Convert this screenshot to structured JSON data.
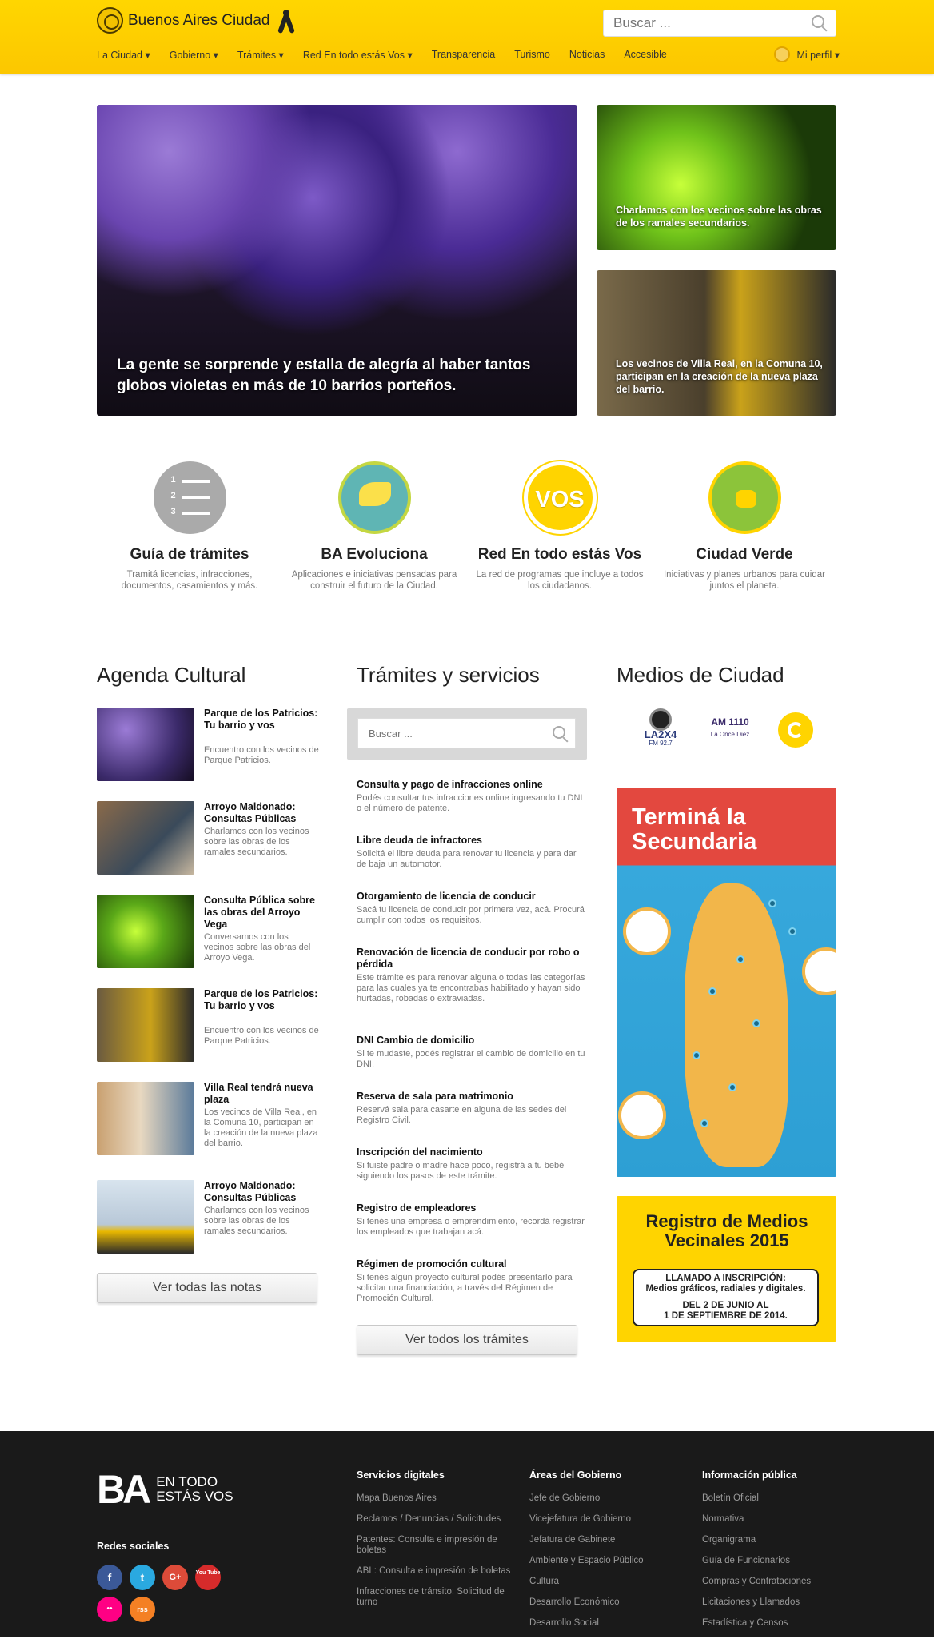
{
  "header": {
    "site_name": "Buenos Aires Ciudad",
    "search_placeholder": "Buscar ...",
    "nav": [
      "La Ciudad ▾",
      "Gobierno ▾",
      "Trámites ▾",
      "Red En todo estás Vos ▾",
      "Transparencia",
      "Turismo",
      "Noticias",
      "Accesible"
    ],
    "profile": "Mi perfil ▾"
  },
  "hero": {
    "main_caption": "La gente se sorprende y estalla de alegría al haber tantos globos violetas en más de 10 barrios porteños.",
    "side1_caption": "Charlamos con los vecinos sobre las obras de los ramales secundarios.",
    "side2_caption": "Los vecinos de Villa Real, en la Comuna 10, participan en la creación de la nueva plaza del barrio."
  },
  "features": [
    {
      "title": "Guía de trámites",
      "desc": "Tramitá licencias, infracciones, documentos, casamientos y más.",
      "icon": "list-icon"
    },
    {
      "title": "BA Evoluciona",
      "desc": "Aplicaciones e iniciativas pensadas para construir el futuro de la Ciudad.",
      "icon": "ba-evoluciona-logo"
    },
    {
      "title": "Red En todo estás Vos",
      "desc": "La red de programas que incluye a todos los ciudadanos.",
      "icon": "vos-logo",
      "logo_text": "VOS"
    },
    {
      "title": "Ciudad Verde",
      "desc": "Iniciativas y planes urbanos para cuidar juntos el planeta.",
      "icon": "ciudad-verde-logo"
    }
  ],
  "agenda": {
    "title": "Agenda Cultural",
    "items": [
      {
        "title": "Parque de los Patricios: Tu barrio y vos",
        "desc": "Encuentro con los vecinos de Parque Patricios."
      },
      {
        "title": "Arroyo Maldonado: Consultas Públicas",
        "desc": "Charlamos con los vecinos sobre las obras de los ramales secundarios."
      },
      {
        "title": "Consulta Pública sobre las obras del Arroyo Vega",
        "desc": "Conversamos con los vecinos sobre las obras del Arroyo Vega."
      },
      {
        "title": "Parque de los Patricios: Tu barrio y vos",
        "desc": "Encuentro con los vecinos de Parque Patricios."
      },
      {
        "title": "Villa Real tendrá nueva plaza",
        "desc": "Los vecinos de Villa Real, en la Comuna 10, participan en la creación de la nueva plaza del barrio."
      },
      {
        "title": "Arroyo Maldonado: Consultas Públicas",
        "desc": "Charlamos con los vecinos sobre las obras de los ramales secundarios."
      }
    ],
    "button": "Ver todas las notas"
  },
  "tramites": {
    "title": "Trámites y servicios",
    "search_placeholder": "Buscar ...",
    "items": [
      {
        "title": "Consulta y pago de infracciones online",
        "desc": "Podés consultar tus infracciones online ingresando tu DNI o el número de patente."
      },
      {
        "title": "Libre deuda de infractores",
        "desc": "Solicitá el libre deuda para renovar tu licencia y para dar de baja un automotor."
      },
      {
        "title": "Otorgamiento de licencia de conducir",
        "desc": "Sacá tu licencia de conducir por primera vez, acá. Procurá cumplir con todos los requisitos."
      },
      {
        "title": "Renovación de licencia de conducir por robo o pérdida",
        "desc": "Este trámite es para renovar alguna o todas las categorías para las cuales ya te encontrabas habilitado y hayan sido hurtadas, robadas o extraviadas."
      },
      {
        "title": "DNI Cambio de domicilio",
        "desc": "Si te mudaste, podés registrar el cambio de domicilio en tu DNI."
      },
      {
        "title": "Reserva de sala para matrimonio",
        "desc": "Reservá sala para casarte en alguna de las sedes del Registro Civil."
      },
      {
        "title": "Inscripción del nacimiento",
        "desc": "Si fuiste padre o madre hace poco, registrá a tu bebé siguiendo los pasos de este trámite."
      },
      {
        "title": "Registro de empleadores",
        "desc": "Si tenés una empresa o emprendimiento, recordá registrar los empleados que trabajan acá."
      },
      {
        "title": "Régimen de promoción cultural",
        "desc": "Si tenés algún proyecto cultural podés presentarlo para solicitar una financiación, a través del Régimen de Promoción Cultural."
      }
    ],
    "button": "Ver todos los trámites"
  },
  "medios": {
    "title": "Medios de Ciudad",
    "radio1_main": "LA2X4",
    "radio1_sub": "FM 92.7",
    "radio2_main": "AM 1110",
    "radio2_sub": "La Once Diez",
    "ad1_title": "Terminá la Secundaria",
    "ad2_title": "Registro de Medios Vecinales 2015",
    "ad2_line1": "LLAMADO A INSCRIPCIÓN:",
    "ad2_line2": "Medios gráficos, radiales y digitales.",
    "ad2_line3": "DEL 2 DE JUNIO AL",
    "ad2_line4": "1 DE SEPTIEMBRE DE 2014."
  },
  "footer": {
    "logo_ba": "BA",
    "logo_line1": "EN TODO",
    "logo_line2": "ESTÁS VOS",
    "social_title": "Redes sociales",
    "social": [
      "f",
      "t",
      "G+",
      "You Tube",
      "••",
      "rss"
    ],
    "col1": {
      "title": "Servicios digitales",
      "links": [
        "Mapa Buenos Aires",
        "Reclamos / Denuncias / Solicitudes",
        "Patentes: Consulta e impresión de boletas",
        "ABL: Consulta e impresión de boletas",
        "Infracciones de tránsito: Solicitud de turno"
      ]
    },
    "col2": {
      "title": "Áreas del Gobierno",
      "links": [
        "Jefe de Gobierno",
        "Vicejefatura de Gobierno",
        "Jefatura de Gabinete",
        "Ambiente y Espacio Público",
        "Cultura",
        "Desarrollo Económico",
        "Desarrollo Social"
      ]
    },
    "col3": {
      "title": "Información pública",
      "links": [
        "Boletín Oficial",
        "Normativa",
        "Organigrama",
        "Guía de Funcionarios",
        "Compras y Contrataciones",
        "Licitaciones y Llamados",
        "Estadística y Censos"
      ]
    }
  },
  "colors": {
    "header_yellow": "#ffd600",
    "footer_bg": "#1a1a1a",
    "vos_yellow": "#ffd400",
    "verde": "#8cc43a"
  }
}
